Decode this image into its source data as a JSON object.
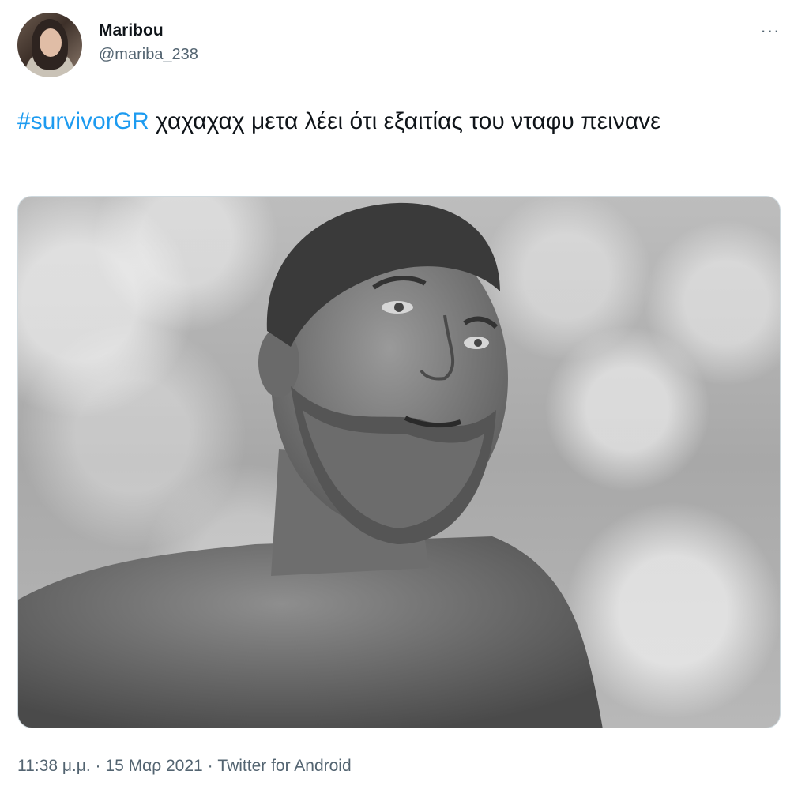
{
  "author": {
    "display_name": "Maribou",
    "handle": "@mariba_238"
  },
  "menu": {
    "more_icon": "ellipsis-horizontal-icon",
    "more_label": "···"
  },
  "tweet": {
    "hashtag": "#survivorGR",
    "text": " χαχαχαχ μετα λέει ότι εξαιτίας του νταφυ πειναvε"
  },
  "metadata": {
    "time": "11:38 μ.μ.",
    "separator": "·",
    "date": "15 Μαρ 2021",
    "source": "Twitter for Android"
  },
  "colors": {
    "hashtag": "#1d9bf0",
    "secondary_text": "#536471",
    "primary_text": "#0f1419"
  }
}
